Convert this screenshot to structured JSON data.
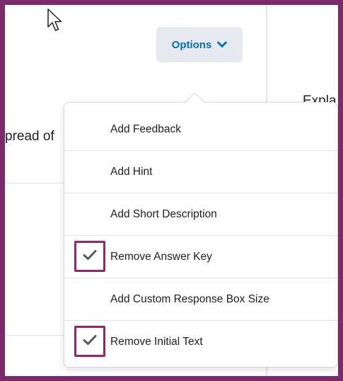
{
  "header": {
    "options_label": "Options"
  },
  "background": {
    "row_text": "pread of",
    "right_col_text": "Expla"
  },
  "menu": {
    "items": [
      {
        "label": "Add Feedback",
        "checked": false,
        "icon": ""
      },
      {
        "label": "Add Hint",
        "checked": false,
        "icon": ""
      },
      {
        "label": "Add Short Description",
        "checked": false,
        "icon": ""
      },
      {
        "label": "Remove Answer Key",
        "checked": true,
        "icon": "checkmark-icon"
      },
      {
        "label": "Add Custom Response Box Size",
        "checked": false,
        "icon": ""
      },
      {
        "label": "Remove Initial Text",
        "checked": true,
        "icon": "checkmark-icon"
      }
    ]
  },
  "colors": {
    "frame": "#7b2a6b",
    "highlight": "#9c2565",
    "accent": "#006fbf",
    "button_bg": "#e6eaf0"
  }
}
